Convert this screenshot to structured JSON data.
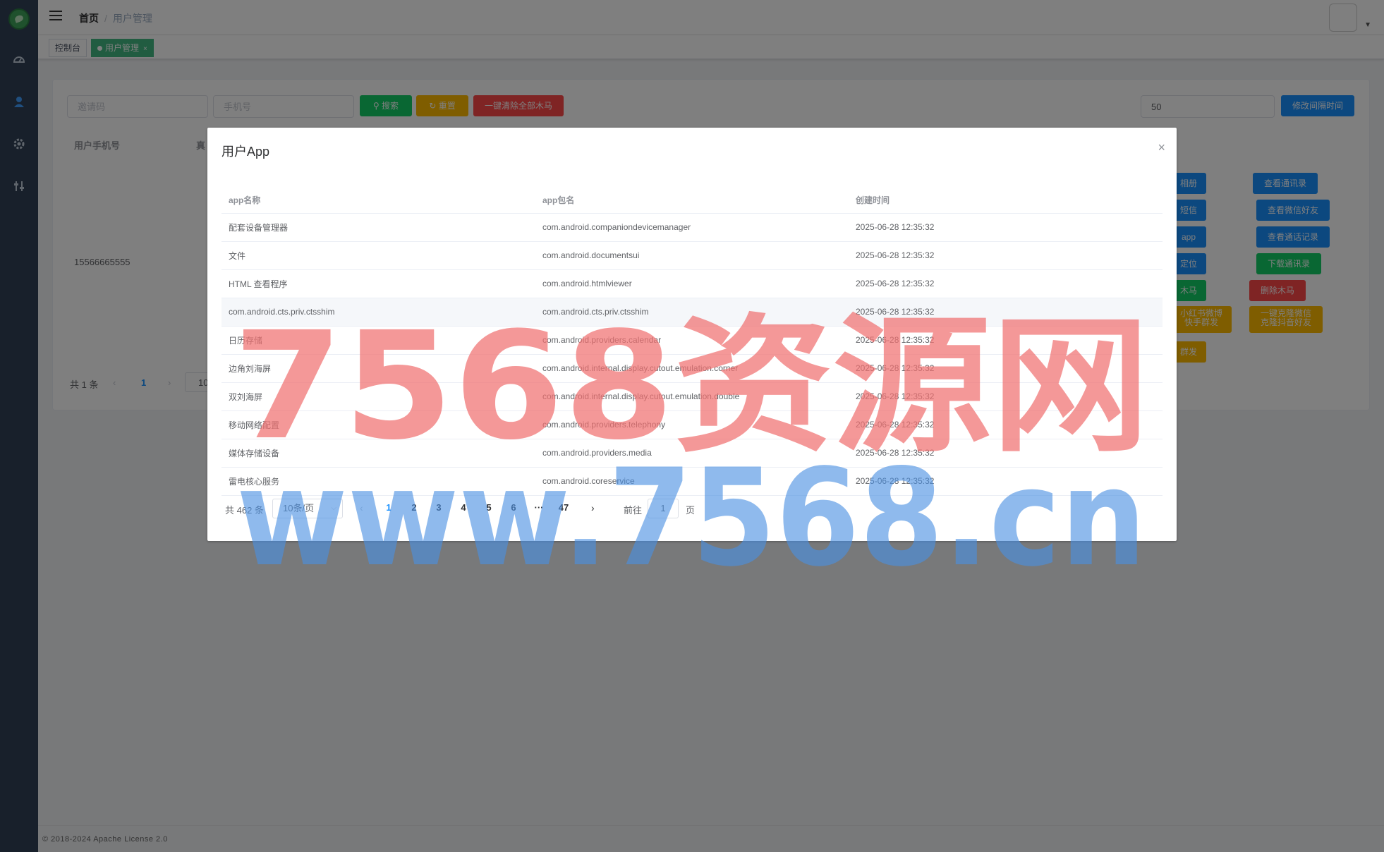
{
  "header": {
    "breadcrumb": [
      "首页",
      "用户管理"
    ]
  },
  "tags": [
    {
      "label": "控制台"
    },
    {
      "label": "用户管理",
      "close": "×"
    }
  ],
  "search": {
    "invite_placeholder": "邀请码",
    "phone_placeholder": "手机号",
    "search_label": "搜索",
    "reset_label": "重置",
    "clear_all_label": "一键清除全部木马",
    "interval_value": "50",
    "modify_interval_label": "修改间隔时间"
  },
  "background_table": {
    "col_phone": "用户手机号",
    "col_real_partial": "真",
    "phone": "15566665555",
    "actions": {
      "album": "相册",
      "contacts": "查看通讯录",
      "sms": "短信",
      "wechat_friends": "查看微信好友",
      "app": "app",
      "call_log": "查看通话记录",
      "location": "定位",
      "download_contacts": "下载通讯录",
      "trojan": "木马",
      "delete_trojan": "删除木马",
      "xhs_line1": "小红书微博",
      "xhs_line2": "快手群发",
      "clone_line1": "一键克隆微信",
      "clone_line2": "克隆抖音好友",
      "mass_send": "群发"
    },
    "pager": {
      "total": "共 1 条",
      "page": "1",
      "size_partial": "10"
    }
  },
  "footer": "© 2018-2024 Apache License 2.0",
  "dialog": {
    "title": "用户App",
    "close": "×",
    "columns": [
      "app名称",
      "app包名",
      "创建时间"
    ],
    "rows": [
      [
        "配套设备管理器",
        "com.android.companiondevicemanager",
        "2025-06-28 12:35:32"
      ],
      [
        "文件",
        "com.android.documentsui",
        "2025-06-28 12:35:32"
      ],
      [
        "HTML 查看程序",
        "com.android.htmlviewer",
        "2025-06-28 12:35:32"
      ],
      [
        "com.android.cts.priv.ctsshim",
        "com.android.cts.priv.ctsshim",
        "2025-06-28 12:35:32"
      ],
      [
        "日历存储",
        "com.android.providers.calendar",
        "2025-06-28 12:35:32"
      ],
      [
        "边角刘海屏",
        "com.android.internal.display.cutout.emulation.corner",
        "2025-06-28 12:35:32"
      ],
      [
        "双刘海屏",
        "com.android.internal.display.cutout.emulation.double",
        "2025-06-28 12:35:32"
      ],
      [
        "移动网络配置",
        "com.android.providers.telephony",
        "2025-06-28 12:35:32"
      ],
      [
        "媒体存储设备",
        "com.android.providers.media",
        "2025-06-28 12:35:32"
      ],
      [
        "雷电核心服务",
        "com.android.coreservice",
        "2025-06-28 12:35:32"
      ]
    ],
    "pager": {
      "total": "共 462 条",
      "page_size": "10条/页",
      "pages": [
        "1",
        "2",
        "3",
        "4",
        "5",
        "6",
        "47"
      ],
      "ellipsis": "···",
      "goto_label": "前往",
      "goto_value": "1",
      "page_unit": "页"
    }
  },
  "watermark": {
    "line1": "7568资源网",
    "line2": "www.7568.cn"
  },
  "colors": {
    "sidebar": "#304156",
    "primary": "#1890ff",
    "success": "#13ce66",
    "warning": "#ffba00",
    "danger": "#ff4949",
    "tag_active": "#42b983",
    "watermark_red": "#f07070",
    "watermark_blue": "#4a90e2"
  }
}
